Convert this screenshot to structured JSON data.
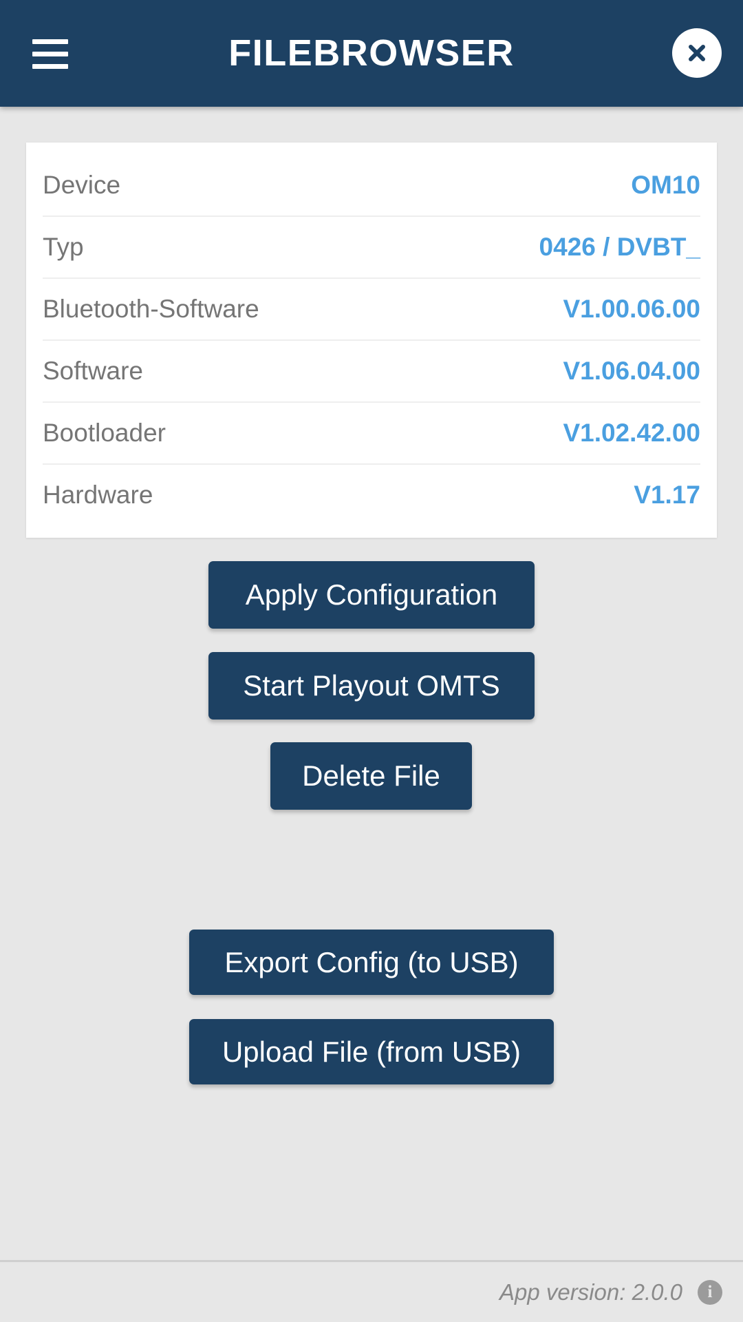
{
  "header": {
    "title": "FILEBROWSER",
    "menu_icon": "hamburger-menu-icon",
    "close_icon": "close-x-icon",
    "background_color": "#1d4163",
    "text_color": "#ffffff"
  },
  "info_card": {
    "accent_color": "#4a9fe0",
    "label_color": "#757575",
    "rows": [
      {
        "label": "Device",
        "value": "OM10"
      },
      {
        "label": "Typ",
        "value": "0426 / DVBT_"
      },
      {
        "label": "Bluetooth-Software",
        "value": "V1.00.06.00"
      },
      {
        "label": "Software",
        "value": "V1.06.04.00"
      },
      {
        "label": "Bootloader",
        "value": "V1.02.42.00"
      },
      {
        "label": "Hardware",
        "value": "V1.17"
      }
    ]
  },
  "actions": {
    "primary_color": "#1d4163",
    "apply_configuration": "Apply Configuration",
    "start_playout": "Start Playout OMTS",
    "delete_file": "Delete File",
    "export_config": "Export Config (to USB)",
    "upload_file": "Upload File (from USB)"
  },
  "footer": {
    "app_version": "App version: 2.0.0",
    "info_icon": "info-circle-icon",
    "info_glyph": "i",
    "text_color": "#8a8a8a"
  }
}
